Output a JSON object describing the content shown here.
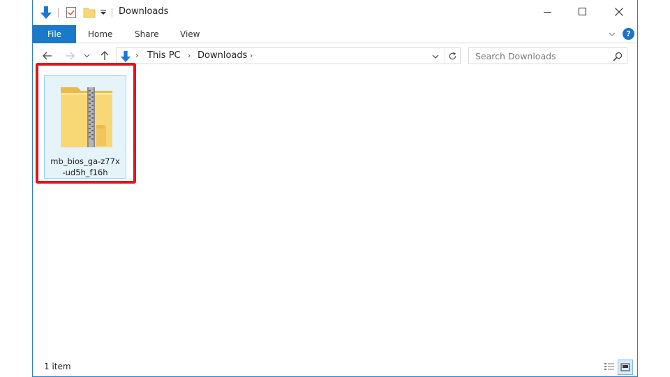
{
  "window": {
    "title": "Downloads"
  },
  "ribbon": {
    "tabs": [
      "File",
      "Home",
      "Share",
      "View"
    ],
    "help_label": "?"
  },
  "address_bar": {
    "breadcrumbs": [
      "This PC",
      "Downloads"
    ],
    "search_placeholder": "Search Downloads"
  },
  "files": [
    {
      "name": "mb_bios_ga-z77x-ud5h_f16h",
      "name_lines": [
        "mb_bios_ga-z77x",
        "-ud5h_f16h"
      ],
      "type_icon": "zip-folder-icon",
      "selected": true
    }
  ],
  "status_bar": {
    "item_count": "1 item"
  },
  "colors": {
    "accent": "#1979ca",
    "selection_fill": "#e5f3fb",
    "selection_border": "#99d1f3",
    "highlight_box": "#e3131b",
    "folder_yellow": "#f8d775"
  }
}
